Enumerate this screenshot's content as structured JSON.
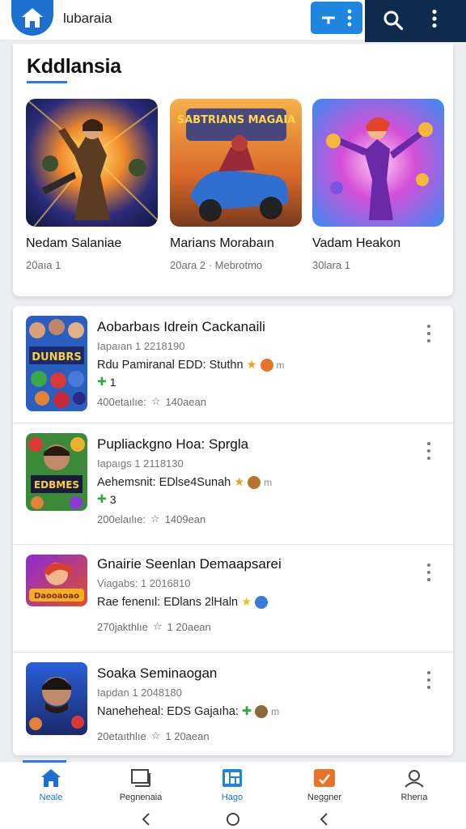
{
  "app": {
    "title": "lubaraia"
  },
  "featured": {
    "title": "Kddlansia",
    "items": [
      {
        "name": "Nedam Salaniae",
        "meta": "20aıa 1"
      },
      {
        "name": "Marians Morabaın",
        "meta": "20ara 2 · Mebrotmo",
        "art_text": "SABTRIANS MAGAIA"
      },
      {
        "name": "Vadam Heakon",
        "meta": "30lara 1"
      }
    ]
  },
  "list": {
    "items": [
      {
        "title": "Aobarbaıs Idrein Cackanaili",
        "sub": "Iapaıan 1 2218190",
        "desc": "Rdu Pamiranal EDD: Stuthn",
        "extra_count": "1",
        "stats": "400etaılıe:",
        "rating": "140aean",
        "art_text": "DUNBRS"
      },
      {
        "title": "Pupliackgno Hoa: Sprgla",
        "sub": "Iapaıgs 1 2118130",
        "desc": "Aehemsnit: EDlse4Sunah",
        "extra_count": "3",
        "stats": "200elaılıe:",
        "rating": "1409ean",
        "art_text": "EDBMES"
      },
      {
        "title": "Gnairie Seenlan Demaapsarei",
        "sub": "Viagabs: 1 2016810",
        "desc": "Rae fenenıl: EDlans 2lHaln",
        "stats": "270jakthlıe",
        "rating": "1 20aean",
        "art_text": "Daooaoao"
      },
      {
        "title": "Soaka Seminaogan",
        "sub": "Iapdan 1 2048180",
        "desc": "Naneheheal: EDS Gajaıha:",
        "stats": "20etaıthlıe",
        "rating": "1 20aean"
      }
    ]
  },
  "nav": {
    "items": [
      {
        "label": "Neale",
        "icon": "home-icon"
      },
      {
        "label": "Pegnenaia",
        "icon": "library-icon"
      },
      {
        "label": "Hago",
        "icon": "apps-icon"
      },
      {
        "label": "Neggner",
        "icon": "update-icon"
      },
      {
        "label": "Rherıa",
        "icon": "profile-icon"
      }
    ]
  },
  "colors": {
    "accent": "#2a7de1",
    "dark": "#0e2a4d",
    "orange": "#e8742c"
  }
}
